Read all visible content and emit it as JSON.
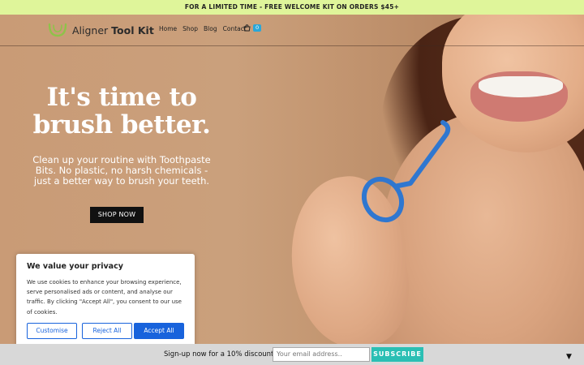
{
  "promo": {
    "text": "FOR A LIMITED TIME - FREE WELCOME KIT ON ORDERS $45+"
  },
  "header": {
    "logo_light": "Aligner ",
    "logo_bold": "Tool Kit",
    "nav": [
      "Home",
      "Shop",
      "Blog",
      "Contact"
    ],
    "cart_count": "0"
  },
  "hero": {
    "headline_line1": "It's time to",
    "headline_line2": "brush better.",
    "subtext": "Clean up your routine with Toothpaste Bits. No plastic, no harsh chemicals - just a better way to brush your teeth.",
    "cta": "SHOP NOW"
  },
  "cookie": {
    "title": "We value your privacy",
    "body": "We use cookies to enhance your browsing experience, serve personalised ads or content, and analyse our traffic. By clicking \"Accept All\", you consent to our use of cookies.",
    "customise": "Customise",
    "reject": "Reject All",
    "accept": "Accept All"
  },
  "signup": {
    "text": "Sign-up now for a 10% discount!",
    "placeholder": "Your email address..",
    "button": "SUBSCRIBE"
  },
  "colors": {
    "promo_bg": "#dff59a",
    "accent_blue": "#1863dc",
    "subscribe": "#2abfb4",
    "badge": "#2aa7d8"
  },
  "icons": {
    "cart": "cart-icon",
    "chevron": "chevron-down-icon",
    "logo": "aligner-logo-icon"
  }
}
